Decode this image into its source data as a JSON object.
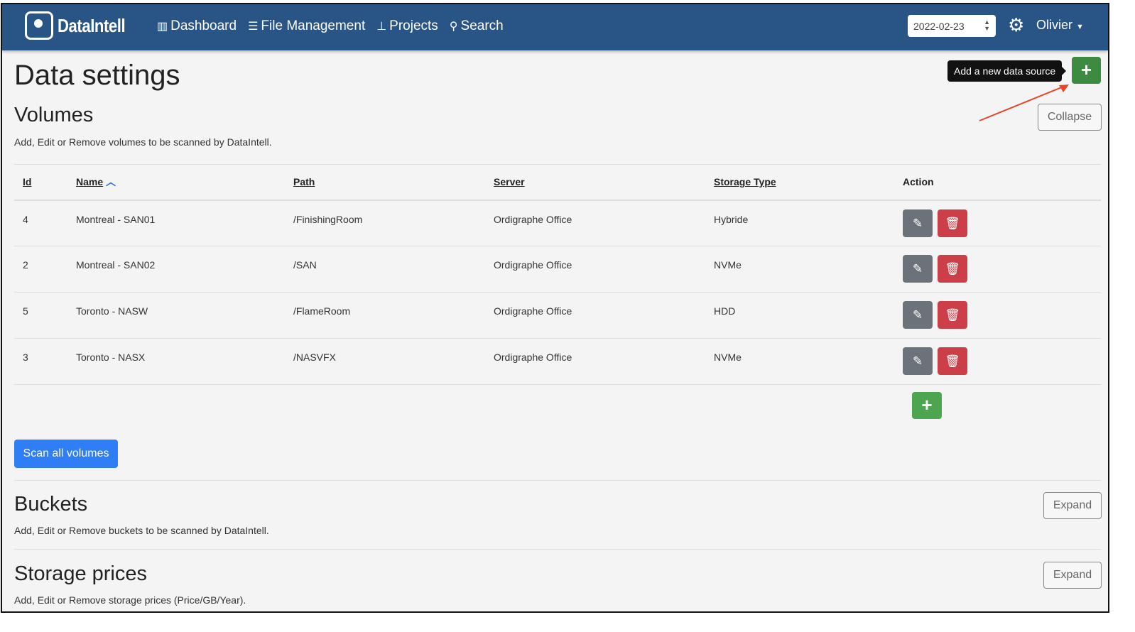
{
  "nav": {
    "brand": "DataIntell",
    "links": [
      {
        "label": "Dashboard",
        "icon": "bar-chart-icon"
      },
      {
        "label": "File Management",
        "icon": "server-icon"
      },
      {
        "label": "Projects",
        "icon": "sitemap-icon"
      },
      {
        "label": "Search",
        "icon": "search-icon"
      }
    ],
    "date": "2022-02-23",
    "user": "Olivier"
  },
  "page": {
    "title": "Data settings",
    "add_tooltip": "Add a new data source",
    "add_label": "+"
  },
  "volumes": {
    "title": "Volumes",
    "description": "Add, Edit or Remove volumes to be scanned by DataIntell.",
    "toggle": "Collapse",
    "columns": [
      "Id",
      "Name",
      "Path",
      "Server",
      "Storage Type",
      "Action"
    ],
    "rows": [
      {
        "id": "4",
        "name": "Montreal - SAN01",
        "path": "/FinishingRoom",
        "server": "Ordigraphe Office",
        "type": "Hybride"
      },
      {
        "id": "2",
        "name": "Montreal - SAN02",
        "path": "/SAN",
        "server": "Ordigraphe Office",
        "type": "NVMe"
      },
      {
        "id": "5",
        "name": "Toronto - NASW",
        "path": "/FlameRoom",
        "server": "Ordigraphe Office",
        "type": "HDD"
      },
      {
        "id": "3",
        "name": "Toronto - NASX",
        "path": "/NASVFX",
        "server": "Ordigraphe Office",
        "type": "NVMe"
      }
    ],
    "add_label": "+",
    "scan_label": "Scan all volumes"
  },
  "buckets": {
    "title": "Buckets",
    "description": "Add, Edit or Remove buckets to be scanned by DataIntell.",
    "toggle": "Expand"
  },
  "prices": {
    "title": "Storage prices",
    "description": "Add, Edit or Remove storage prices (Price/GB/Year).",
    "toggle": "Expand"
  },
  "colors": {
    "navbar": "#285585",
    "add": "#3d8b40",
    "edit": "#6b7279",
    "delete": "#cc3f48",
    "scan": "#2f7ef5",
    "annotation_arrow": "#e8442a"
  }
}
